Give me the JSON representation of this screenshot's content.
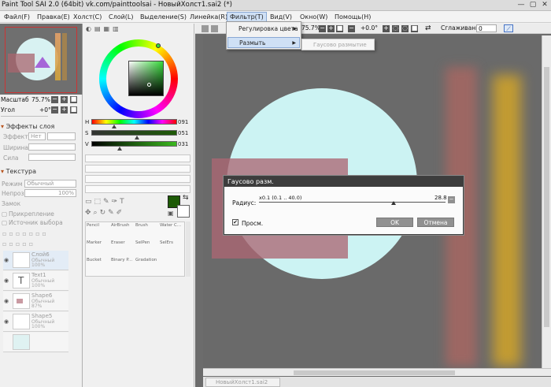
{
  "window": {
    "title": "Paint Tool SAI 2.0 (64bit) vk.com/painttoolsai - НовыйХолст1.sai2 (*)",
    "min_glyph": "—",
    "max_glyph": "▢",
    "close_glyph": "✕"
  },
  "menu": {
    "file": "Файл(F)",
    "edit": "Правка(E)",
    "canvas": "Холст(C)",
    "layer": "Слой(L)",
    "selection": "Выделение(S)",
    "ruler": "Линейка(R)",
    "filter": "Фильтр(T)",
    "view": "Вид(V)",
    "window": "Окно(W)",
    "help": "Помощь(H)"
  },
  "filter_menu": {
    "items": [
      {
        "label": "Регулировка цвета",
        "arrow": "▶"
      },
      {
        "label": "Размыть",
        "arrow": "▶"
      }
    ],
    "submenu_item": "Гаусово размытие"
  },
  "nav": {
    "scale_label": "Масштаб",
    "scale_value": "75.7%",
    "angle_label": "Угол",
    "angle_value": "+0°"
  },
  "layer_effects": {
    "header": "Эффекты слоя",
    "effect_label": "Эффект",
    "effect_value": "Нет",
    "width_label": "Ширина",
    "strength_label": "Сила"
  },
  "texture": {
    "header": "Текстура",
    "mode_label": "Режим",
    "mode_value": "Обычный",
    "opacity_label": "Непроз.",
    "opacity_value": "100%",
    "lock_label": "Замок",
    "clip_label": "Прикрепление",
    "source_label": "Источник выбора"
  },
  "layers": [
    {
      "name": "Слой6",
      "mode": "Обычный",
      "opacity": "100%"
    },
    {
      "name": "Text1",
      "mode": "Обычный",
      "opacity": "100%"
    },
    {
      "name": "Shape6",
      "mode": "Обычный",
      "opacity": "87%"
    },
    {
      "name": "Shape5",
      "mode": "Обычный",
      "opacity": "100%"
    }
  ],
  "color": {
    "h_label": "H",
    "h_value": "091",
    "s_label": "S",
    "s_value": "051",
    "v_label": "V",
    "v_value": "031",
    "primary": "#1d5a06",
    "wheel_marker": "#36d93a"
  },
  "brushes": {
    "row1": [
      "Pencil",
      "AirBrush",
      "Brush",
      "Water C..."
    ],
    "row2": [
      "Marker",
      "Eraser",
      "SelPen",
      "SelErs"
    ],
    "row3": [
      "Bucket",
      "Binary P...",
      "Gradation"
    ]
  },
  "toolbar": {
    "zoom": "75.7%",
    "angle": "+0.0°",
    "smoothing_label": "Сглаживание",
    "smoothing_value": "0"
  },
  "dialog": {
    "title": "Гаусово разм.",
    "radius_label": "Радиус:",
    "range_text": "x0.1 (0.1 .. 40.0)",
    "radius_value": "28.8",
    "preview_label": "Просм.",
    "preview_checked": "✔",
    "ok_label": "OK",
    "cancel_label": "Отмена"
  },
  "tab": {
    "label": "НовыйХолст1.sai2"
  }
}
